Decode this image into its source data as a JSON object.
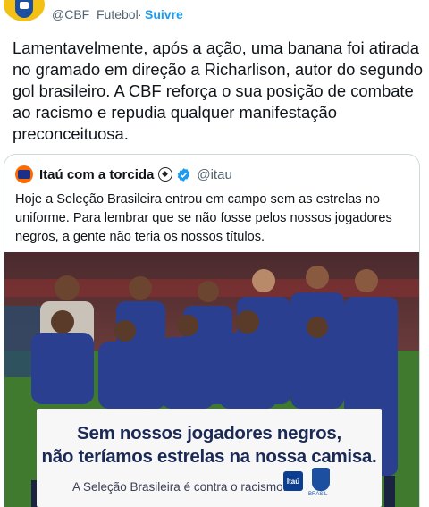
{
  "header": {
    "handle": "@CBF_Futebol",
    "separator": "·",
    "follow_label": "Suivre"
  },
  "tweet": {
    "text": "Lamentavelmente, após a ação, uma banana foi atirada no gramado em direção a Richarlison, autor do segundo gol brasileiro. A CBF reforça o sua posição de combate ao racismo e repudia qualquer manifestação preconceituosa."
  },
  "quote": {
    "name": "Itaú com a torcida",
    "handle": "@itau",
    "text": "Hoje a Seleção Brasileira entrou em campo sem as estrelas no uniforme. Para lembrar que se não fosse pelos nossos jogadores negros, a gente não teria os nossos títulos.",
    "banner": {
      "line1": "Sem nossos jogadores negros,",
      "line2": "não teríamos estrelas na nossa camisa.",
      "line3": "A Seleção Brasileira é contra o racismo.",
      "itau_logo": "Itaú",
      "cbf_sub": "BRASIL"
    }
  },
  "colors": {
    "link": "#1d9bf0",
    "secondary_text": "#536471",
    "jersey_blue": "#2a3f8f",
    "pitch_green": "#3f7a2e"
  },
  "icons": [
    "cbf-crest-icon",
    "itau-avatar-icon",
    "soccer-ball-icon",
    "verified-badge-icon"
  ]
}
